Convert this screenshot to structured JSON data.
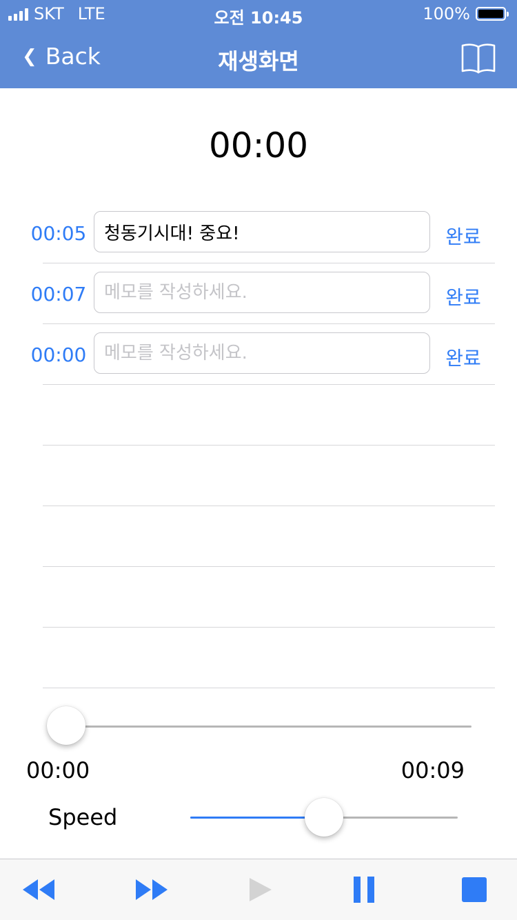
{
  "status_bar": {
    "carrier": "SKT",
    "network": "LTE",
    "time": "오전 10:45",
    "battery": "100%"
  },
  "nav": {
    "back_label": "Back",
    "title": "재생화면",
    "book_icon": "book-icon"
  },
  "timer": "00:00",
  "memos": [
    {
      "time": "00:05",
      "value": "청동기시대! 중요!",
      "placeholder": "",
      "done_label": "완료"
    },
    {
      "time": "00:07",
      "value": "",
      "placeholder": "메모를 작성하세요.",
      "done_label": "완료"
    },
    {
      "time": "00:00",
      "value": "",
      "placeholder": "메모를 작성하세요.",
      "done_label": "완료"
    }
  ],
  "playback": {
    "current_time": "00:00",
    "total_time": "00:09",
    "progress": 0.0
  },
  "speed": {
    "label": "Speed",
    "value": 0.5
  },
  "toolbar": {
    "icons": [
      "rewind-icon",
      "fast-forward-icon",
      "play-icon",
      "pause-icon",
      "stop-icon"
    ],
    "play_enabled": false
  },
  "colors": {
    "nav_bg": "#5E8BD6",
    "accent": "#2F7CF6",
    "disabled": "#D3D3D3"
  }
}
